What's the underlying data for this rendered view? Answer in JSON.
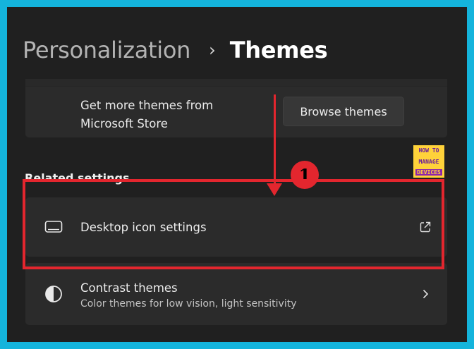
{
  "breadcrumb": {
    "parent": "Personalization",
    "separator": "›",
    "current": "Themes"
  },
  "store": {
    "text_line1": "Get more themes from",
    "text_line2": "Microsoft Store",
    "browse_label": "Browse themes"
  },
  "related": {
    "heading": "Related settings",
    "desktop": {
      "title": "Desktop icon settings",
      "icon": "monitor-icon",
      "trail_icon": "open-external-icon"
    },
    "contrast": {
      "title": "Contrast themes",
      "subtitle": "Color themes for low vision, light sensitivity",
      "icon": "contrast-icon",
      "trail_icon": "chevron-right-icon"
    }
  },
  "annotation": {
    "marker": "1",
    "color": "#e3262e"
  },
  "watermark": {
    "line1": "HOW TO",
    "line2": "MANAGE",
    "line3": "DEVICES"
  },
  "colors": {
    "frame": "#14b4dc",
    "background": "#202020",
    "card": "#2b2b2b"
  }
}
